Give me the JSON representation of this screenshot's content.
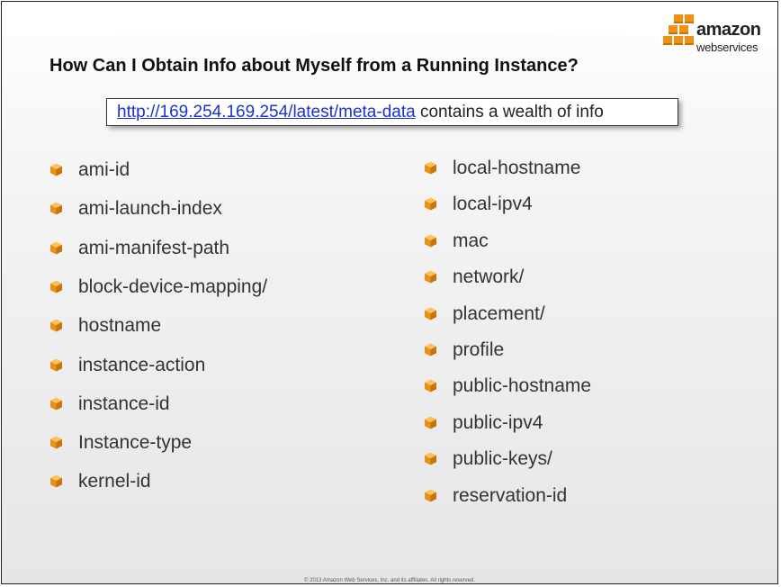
{
  "logo": {
    "line1": "amazon",
    "line2": "webservices"
  },
  "title": "How Can I Obtain Info about Myself from a Running Instance?",
  "url_box": {
    "link": "http://169.254.169.254/latest/meta-data",
    "rest": " contains a wealth of info"
  },
  "left_items": [
    "ami-id",
    "ami-launch-index",
    "ami-manifest-path",
    "block-device-mapping/",
    "hostname",
    "instance-action",
    "instance-id",
    "Instance-type",
    "kernel-id"
  ],
  "right_items": [
    "local-hostname",
    "local-ipv4",
    "mac",
    "network/",
    "placement/",
    "profile",
    "public-hostname",
    "public-ipv4",
    "public-keys/",
    "reservation-id"
  ],
  "footer": "© 2013 Amazon Web Services, Inc. and its affiliates. All rights reserved.",
  "colors": {
    "bullet": "#f0a020",
    "link": "#1a33cc"
  },
  "icons": {
    "bullet": "cube-bullet-icon"
  }
}
